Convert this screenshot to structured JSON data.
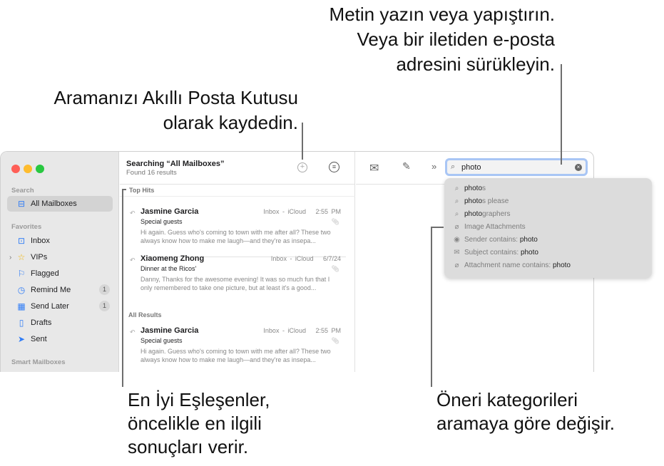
{
  "callouts": {
    "search_field": [
      "Metin yazın veya yapıştırın.",
      "Veya bir iletiden e-posta",
      "adresini sürükleyin."
    ],
    "save_search": [
      "Aramanızı Akıllı Posta Kutusu",
      "olarak kaydedin."
    ],
    "top_hits": [
      "En İyi Eşleşenler,",
      "öncelikle en ilgili",
      "sonuçları verir."
    ],
    "suggestions": [
      "Öneri kategorileri",
      "aramaya göre değişir."
    ]
  },
  "sidebar": {
    "search_section": "Search",
    "search_items": [
      {
        "label": "All Mailboxes",
        "icon": "all-mailboxes-icon"
      }
    ],
    "favorites_section": "Favorites",
    "favorites": [
      {
        "label": "Inbox",
        "icon": "inbox-icon"
      },
      {
        "label": "VIPs",
        "icon": "star-icon"
      },
      {
        "label": "Flagged",
        "icon": "flag-icon"
      },
      {
        "label": "Remind Me",
        "icon": "clock-icon",
        "badge": "1"
      },
      {
        "label": "Send Later",
        "icon": "calendar-icon",
        "badge": "1"
      },
      {
        "label": "Drafts",
        "icon": "document-icon"
      },
      {
        "label": "Sent",
        "icon": "paper-plane-icon"
      }
    ],
    "smart_section": "Smart Mailboxes"
  },
  "list": {
    "title": "Searching “All Mailboxes”",
    "subtitle": "Found 16 results",
    "top_hits_label": "Top Hits",
    "all_results_label": "All Results",
    "messages": [
      {
        "from": "Jasmine Garcia",
        "mailbox": "Inbox - iCloud",
        "time": "2:55 PM",
        "subject": "Special guests",
        "preview": "Hi again. Guess who's coming to town with me after all? These two always know how to make me laugh—and they're as insepa..."
      },
      {
        "from": "Xiaomeng Zhong",
        "mailbox": "Inbox - iCloud",
        "time": "6/7/24",
        "subject": "Dinner at the Ricos'",
        "preview": "Danny, Thanks for the awesome evening! It was so much fun that I only remembered to take one picture, but at least it's a good..."
      },
      {
        "from": "Jasmine Garcia",
        "mailbox": "Inbox - iCloud",
        "time": "2:55 PM",
        "subject": "Special guests",
        "preview": "Hi again. Guess who's coming to town with me after all? These two always know how to make me laugh—and they're as insepa..."
      }
    ]
  },
  "search": {
    "value": "photo"
  },
  "suggestions": [
    {
      "icon": "search-icon",
      "bold": "photo",
      "rest": "s"
    },
    {
      "icon": "search-icon",
      "bold": "photo",
      "rest": "s please"
    },
    {
      "icon": "search-icon",
      "bold": "photo",
      "rest": "graphers"
    },
    {
      "icon": "paperclip-icon",
      "label": "Image Attachments"
    },
    {
      "icon": "person-icon",
      "label": "Sender contains: ",
      "term": "photo"
    },
    {
      "icon": "envelope-icon",
      "label": "Subject contains: ",
      "term": "photo"
    },
    {
      "icon": "paperclip-icon",
      "label": "Attachment name contains: ",
      "term": "photo"
    }
  ],
  "colors": {
    "accent": "#2f7cf6",
    "close": "#ff5f57",
    "minimize": "#febc2e",
    "zoom": "#28c840"
  }
}
